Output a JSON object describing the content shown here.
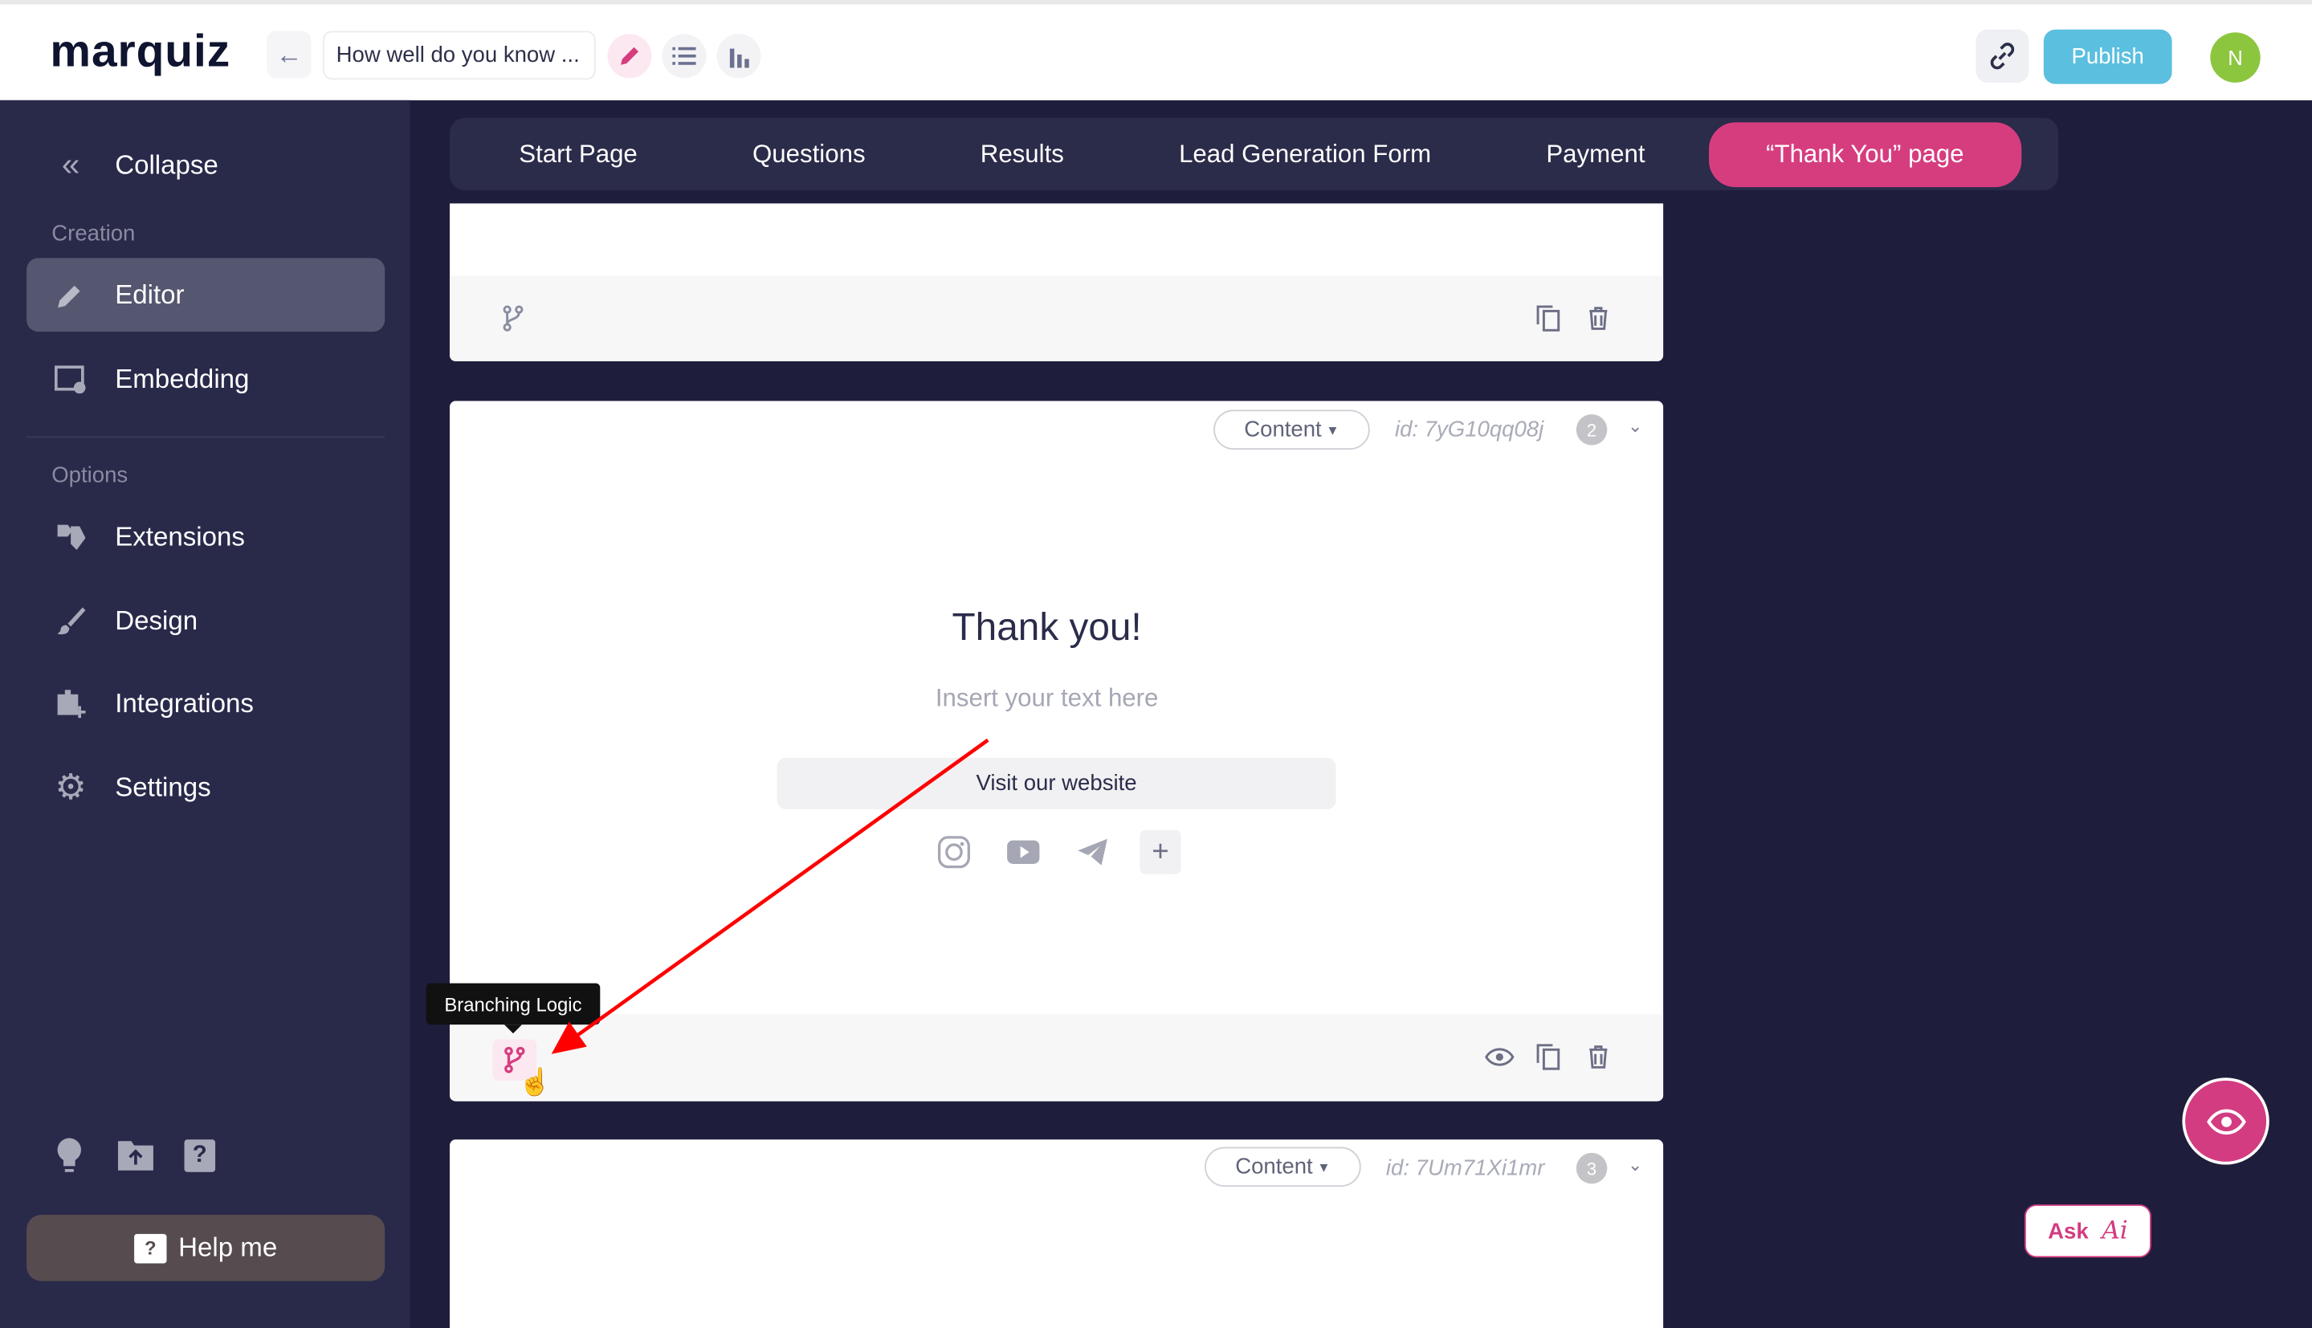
{
  "header": {
    "logo": "marquiz",
    "quiz_title": "How well do you know ...",
    "publish_label": "Publish",
    "avatar_initial": "N"
  },
  "sidebar": {
    "collapse_label": "Collapse",
    "creation_label": "Creation",
    "options_label": "Options",
    "items": [
      {
        "label": "Editor",
        "icon": "pencil-icon",
        "active": true
      },
      {
        "label": "Embedding",
        "icon": "embed-icon"
      },
      {
        "label": "Extensions",
        "icon": "puzzle-icon"
      },
      {
        "label": "Design",
        "icon": "brush-icon"
      },
      {
        "label": "Integrations",
        "icon": "integrations-icon"
      },
      {
        "label": "Settings",
        "icon": "gear-icon"
      }
    ],
    "help_label": "Help me"
  },
  "tabs": [
    {
      "label": "Start Page"
    },
    {
      "label": "Questions"
    },
    {
      "label": "Results"
    },
    {
      "label": "Lead Generation Form"
    },
    {
      "label": "Payment"
    },
    {
      "label": "“Thank You” page",
      "active": true
    }
  ],
  "cards": [
    {
      "type": "Content",
      "id": "id: 7yG10qq08j",
      "number": "2",
      "title": "Thank you!",
      "text": "Insert your text here",
      "button": "Visit our website",
      "tooltip": "Branching Logic"
    },
    {
      "type": "Content",
      "id": "id: 7Um71Xi1mr",
      "number": "3"
    }
  ],
  "ask_ai": {
    "label": "Ask",
    "ai": "Ai"
  },
  "colors": {
    "accent": "#d63d7f",
    "publish": "#5bbfdf",
    "sidebar": "#29294a",
    "background": "#1e1e3c",
    "avatar": "#8cc63f",
    "annotation_arrow": "#ff0000"
  }
}
